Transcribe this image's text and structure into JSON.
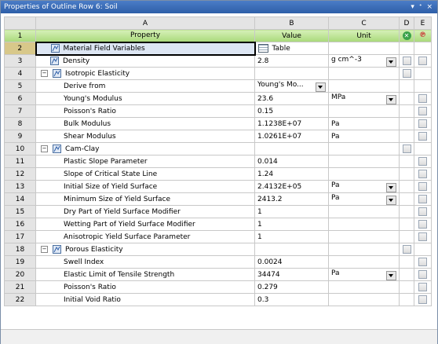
{
  "window": {
    "title": "Properties of Outline Row 6: Soil",
    "controls": [
      "▾",
      "ᐩ",
      "×"
    ]
  },
  "columns": {
    "corner": "",
    "a": "A",
    "b": "B",
    "c": "C",
    "d": "D",
    "e": "E"
  },
  "header_row": {
    "num": "1",
    "property": "Property",
    "value": "Value",
    "unit": "Unit"
  },
  "rows": [
    {
      "num": "2",
      "property": "Material Field Variables",
      "value": "Table",
      "unit": "",
      "type": "mat",
      "selected": true,
      "valueIcon": "table-icon",
      "d": false,
      "e": false
    },
    {
      "num": "3",
      "property": "Density",
      "value": "2.8",
      "unit": "g cm^-3",
      "type": "mat",
      "unitDropdown": true,
      "d": true,
      "e": true
    },
    {
      "num": "4",
      "property": "Isotropic Elasticity",
      "value": "",
      "unit": "",
      "type": "group",
      "d": true,
      "e": false
    },
    {
      "num": "5",
      "property": "Derive from",
      "value": "Young's Mo...",
      "unit": "",
      "type": "child",
      "valueDropdown": true,
      "d": false,
      "e": false
    },
    {
      "num": "6",
      "property": "Young's Modulus",
      "value": "23.6",
      "unit": "MPa",
      "type": "child",
      "unitDropdown": true,
      "d": false,
      "e": true
    },
    {
      "num": "7",
      "property": "Poisson's Ratio",
      "value": "0.15",
      "unit": "",
      "type": "child",
      "d": false,
      "e": true
    },
    {
      "num": "8",
      "property": "Bulk Modulus",
      "value": "1.1238E+07",
      "unit": "Pa",
      "type": "child",
      "d": false,
      "e": true
    },
    {
      "num": "9",
      "property": "Shear Modulus",
      "value": "1.0261E+07",
      "unit": "Pa",
      "type": "child",
      "d": false,
      "e": true
    },
    {
      "num": "10",
      "property": "Cam-Clay",
      "value": "",
      "unit": "",
      "type": "group2",
      "d": true,
      "e": false
    },
    {
      "num": "11",
      "property": "Plastic Slope Parameter",
      "value": "0.014",
      "unit": "",
      "type": "child",
      "d": false,
      "e": true
    },
    {
      "num": "12",
      "property": "Slope of Critical State Line",
      "value": "1.24",
      "unit": "",
      "type": "child",
      "d": false,
      "e": true
    },
    {
      "num": "13",
      "property": "Initial Size of Yield Surface",
      "value": "2.4132E+05",
      "unit": "Pa",
      "type": "child",
      "unitDropdown": true,
      "d": false,
      "e": true
    },
    {
      "num": "14",
      "property": "Minimum Size of Yield Surface",
      "value": "2413.2",
      "unit": "Pa",
      "type": "child",
      "unitDropdown": true,
      "d": false,
      "e": true
    },
    {
      "num": "15",
      "property": "Dry Part of Yield Surface Modifier",
      "value": "1",
      "unit": "",
      "type": "child",
      "d": false,
      "e": true
    },
    {
      "num": "16",
      "property": "Wetting Part of Yield Surface Modifier",
      "value": "1",
      "unit": "",
      "type": "child",
      "d": false,
      "e": true
    },
    {
      "num": "17",
      "property": "Anisotropic Yield Surface Parameter",
      "value": "1",
      "unit": "",
      "type": "child",
      "d": false,
      "e": true
    },
    {
      "num": "18",
      "property": "Porous Elasticity",
      "value": "",
      "unit": "",
      "type": "group",
      "d": true,
      "e": false
    },
    {
      "num": "19",
      "property": "Swell Index",
      "value": "0.0024",
      "unit": "",
      "type": "child",
      "d": false,
      "e": true
    },
    {
      "num": "20",
      "property": "Elastic Limit of Tensile Strength",
      "value": "34474",
      "unit": "Pa",
      "type": "child",
      "unitDropdown": true,
      "d": false,
      "e": true
    },
    {
      "num": "21",
      "property": "Poisson's Ratio",
      "value": "0.279",
      "unit": "",
      "type": "child",
      "d": false,
      "e": true
    },
    {
      "num": "22",
      "property": "Initial Void Ratio",
      "value": "0.3",
      "unit": "",
      "type": "child",
      "d": false,
      "e": true
    }
  ]
}
